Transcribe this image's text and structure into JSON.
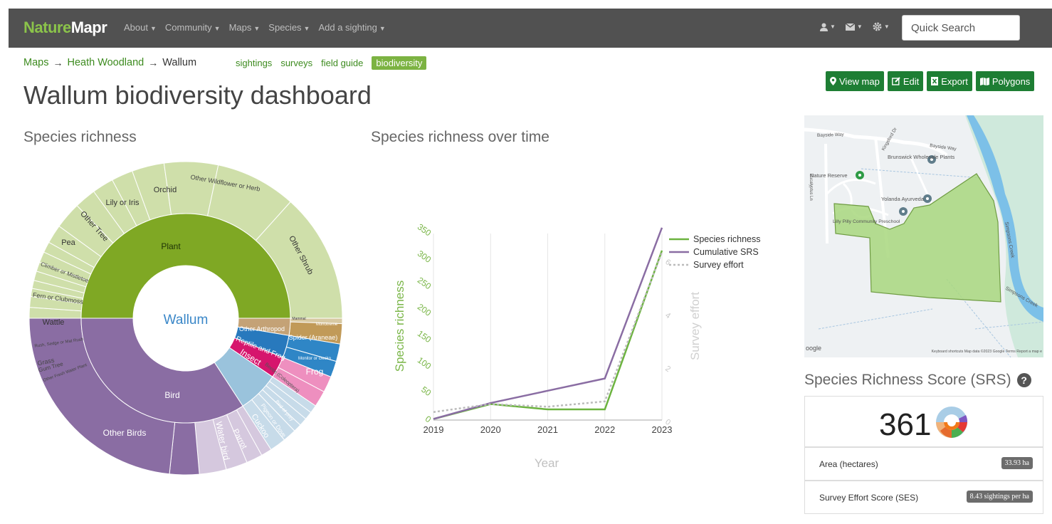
{
  "navbar": {
    "brand_part1": "Nature",
    "brand_part2": "Mapr",
    "menu": [
      "About",
      "Community",
      "Maps",
      "Species",
      "Add a sighting"
    ],
    "icons": [
      "user-icon",
      "mail-icon",
      "gear-icon"
    ],
    "search_placeholder": "Quick Search"
  },
  "breadcrumb": {
    "items": [
      "Maps",
      "Heath Woodland",
      "Wallum"
    ],
    "separator": "→"
  },
  "subnav": {
    "tabs": [
      "sightings",
      "surveys",
      "field guide",
      "biodiversity"
    ],
    "active": "biodiversity"
  },
  "page_title": "Wallum biodiversity dashboard",
  "actions": {
    "view_map": "View map",
    "edit": "Edit",
    "export": "Export",
    "polygons": "Polygons"
  },
  "sunburst": {
    "title": "Species richness",
    "center_label": "Wallum",
    "inner": [
      {
        "label": "Plant",
        "color": "#7fa824"
      },
      {
        "label": "Bird",
        "color": "#8a6da3"
      },
      {
        "label": "Insect",
        "color": "#9ac3dc"
      }
    ],
    "outer_labels": [
      "Other Wildflower or Herb",
      "Other Shrub",
      "Orchid",
      "Lily or Iris",
      "Other Tree",
      "Pea",
      "Climber or Mistletoe",
      "Fern or Clubmoss",
      "Wattle",
      "Rush, Sedge or Mat Rush",
      "Grass",
      "Gum Tree",
      "Other Fresh Water Plant",
      "Other Birds",
      "Water bird",
      "Parrot",
      "Cuckoo",
      "Pigeon or Dove",
      "Bird of prey",
      "Beetle (Coleoptera)",
      "Frog",
      "Reptile and Frog",
      "Spider (Araneae)",
      "Other Arthropod",
      "Monitor or Gecko",
      "Monotreme",
      "Mammal"
    ]
  },
  "chart_data": {
    "type": "line",
    "title": "Species richness over time",
    "xlabel": "Year",
    "ylabel": "Species richness",
    "y2label": "Survey effort",
    "x": [
      "2019",
      "2020",
      "2021",
      "2022",
      "2023"
    ],
    "ylim": [
      0,
      350
    ],
    "y_ticks": [
      0,
      50,
      100,
      150,
      200,
      250,
      300,
      350
    ],
    "y2lim": [
      0,
      7
    ],
    "y2_ticks": [
      0,
      2,
      4,
      6
    ],
    "legend_position": "top-right",
    "series": [
      {
        "name": "Species richness",
        "color": "#6cb33f",
        "style": "solid",
        "axis": "y",
        "values": [
          2,
          30,
          20,
          20,
          318
        ]
      },
      {
        "name": "Cumulative SRS",
        "color": "#8a6da3",
        "style": "solid",
        "axis": "y",
        "values": [
          2,
          32,
          55,
          78,
          361
        ]
      },
      {
        "name": "Survey effort",
        "color": "#bbbbbb",
        "style": "dotted",
        "axis": "y2",
        "values": [
          0.3,
          0.6,
          0.5,
          0.7,
          6.3
        ]
      }
    ]
  },
  "srs": {
    "title": "Species Richness Score (SRS)",
    "value": "361",
    "help_symbol": "?",
    "rows": [
      {
        "label": "Area (hectares)",
        "badge": "33.93 ha"
      },
      {
        "label": "Survey Effort Score (SES)",
        "badge": "8.43 sightings per ha"
      }
    ]
  },
  "map": {
    "labels": [
      "Bayside Way",
      "Bayside Way",
      "Kingsford Dr",
      "Brunswick Wholesale Plants",
      "Nature Reserve",
      "Yolanda Ayurveda",
      "Lilly Pilly Community Preschool",
      "Simpsons Creek",
      "Simpsons Creek",
      "Eucalyptus Ln"
    ],
    "footer": "Keyboard shortcuts   Map data ©2023 Google   Terms   Report a map e",
    "logo": "oogle",
    "polygon_color": "#a8d77e"
  }
}
